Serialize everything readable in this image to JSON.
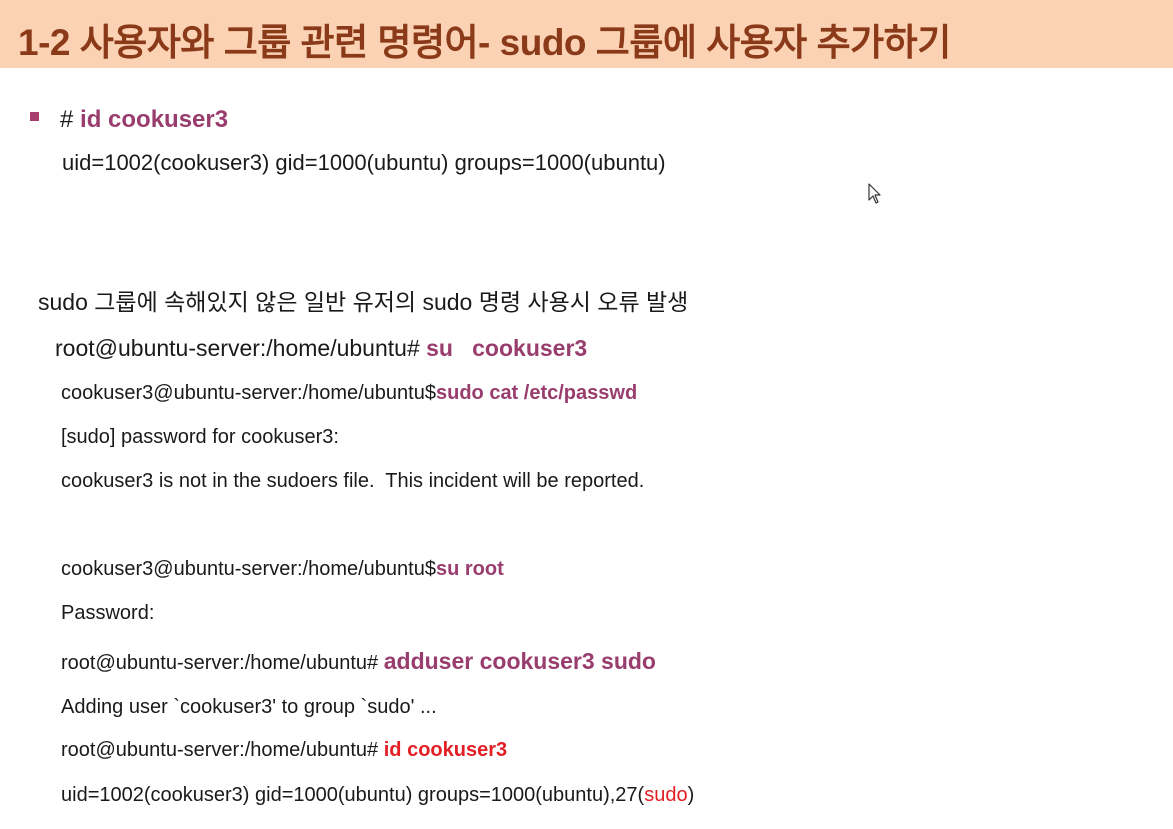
{
  "title": "1-2 사용자와 그룹 관련 명령어- sudo 그룹에 사용자 추가하기",
  "block1": {
    "prompt": "#",
    "command": "id cookuser3",
    "output": "uid=1002(cookuser3) gid=1000(ubuntu) groups=1000(ubuntu)"
  },
  "block2": {
    "heading": "sudo 그룹에 속해있지 않은 일반 유저의 sudo 명령 사용시 오류 발생",
    "lines": [
      {
        "prompt": "root@ubuntu-server:/home/ubuntu#",
        "command": "su   cookuser3"
      },
      {
        "prompt": "cookuser3@ubuntu-server:/home/ubuntu$",
        "command": "sudo cat /etc/passwd"
      },
      {
        "text": "[sudo] password for cookuser3:"
      },
      {
        "text": "cookuser3 is not in the sudoers file.  This incident will be reported."
      },
      {
        "prompt": "cookuser3@ubuntu-server:/home/ubuntu$",
        "command": "su root"
      },
      {
        "text": "Password:"
      },
      {
        "prompt": "root@ubuntu-server:/home/ubuntu#",
        "command": "adduser cookuser3 sudo"
      },
      {
        "text": "Adding user `cookuser3' to group `sudo' ..."
      },
      {
        "prompt": "root@ubuntu-server:/home/ubuntu#",
        "command": "id cookuser3"
      },
      {
        "text": "uid=1002(cookuser3) gid=1000(ubuntu) groups=1000(ubuntu),27(",
        "highlight": "sudo",
        "suffix": ")"
      }
    ]
  },
  "colors": {
    "title_bg": "#fbd3b4",
    "title_text": "#8b3a19",
    "command_highlight": "#993d6e",
    "emphasis_red": "#e31e24"
  },
  "icons": {
    "bullet": "square-bullet-icon",
    "cursor": "mouse-pointer-icon"
  }
}
